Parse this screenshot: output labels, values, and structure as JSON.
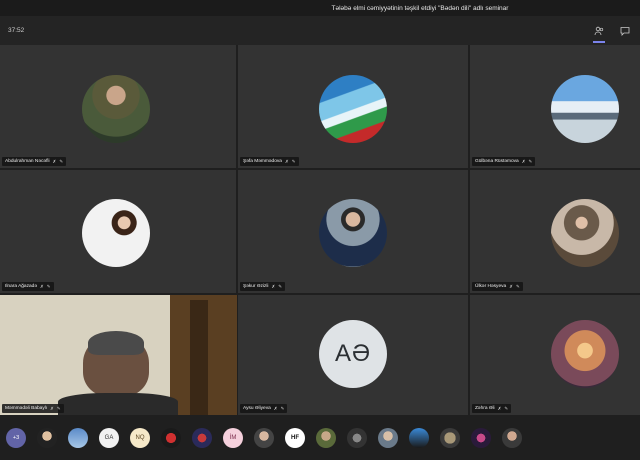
{
  "window": {
    "title": "Tələbə elmi cəmiyyətinin təşkil etdiyi \"Bədən dili\" adlı seminar"
  },
  "toolbar": {
    "timer": "37:52"
  },
  "participants": [
    {
      "name": "Abdulrahman Nəcəfli"
    },
    {
      "name": "Şəfa Məmmədova"
    },
    {
      "name": "Gülbəna Rüstəmova"
    },
    {
      "name": "Ilnara Ağazadə"
    },
    {
      "name": "Şəkur Əzizli"
    },
    {
      "name": "Ülkər Həsyeva"
    },
    {
      "name": "Məmmədəli Babaylı"
    },
    {
      "name": "Aysu Əliyeva",
      "initials": "AƏ"
    },
    {
      "name": "Zəhra Əli"
    }
  ],
  "icons": {
    "mic": "mic-off-icon",
    "pin": "pin-icon"
  },
  "strip": {
    "more": "+3",
    "initials": [
      "GA",
      "NQ",
      "İM",
      "HF"
    ]
  },
  "colors": {
    "accent": "#6264a7",
    "tile": "#333333",
    "bg": "#1f1f1f"
  }
}
